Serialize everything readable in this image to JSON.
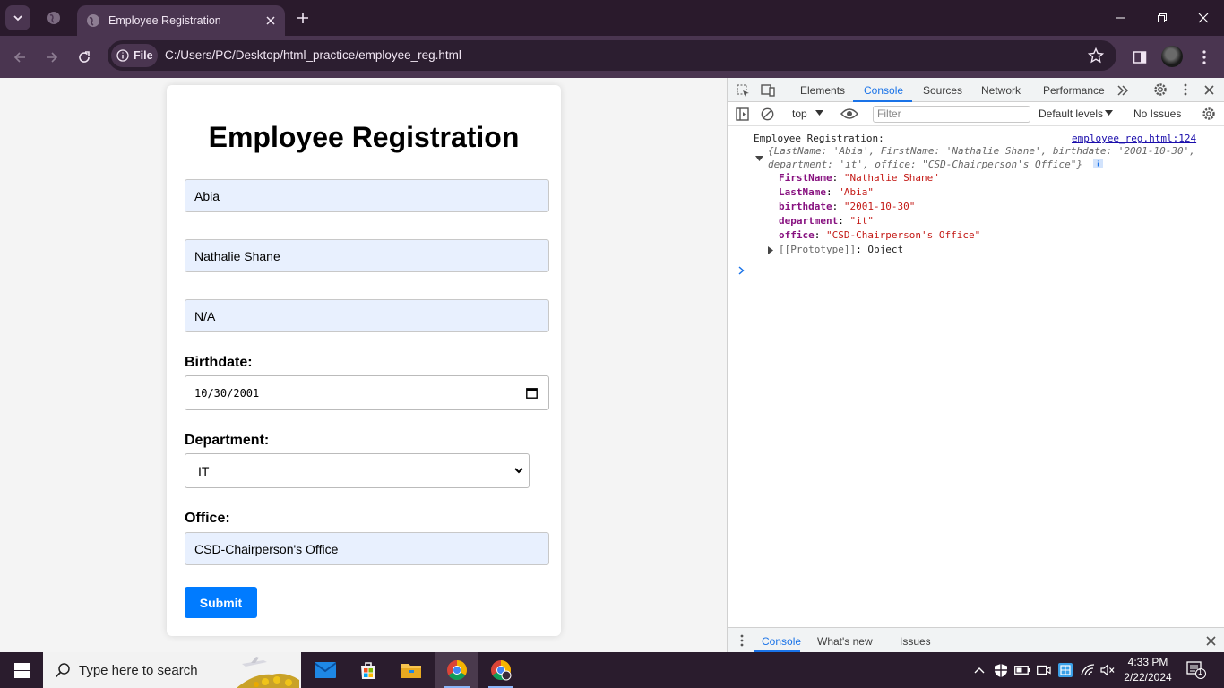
{
  "browser": {
    "tab_title": "Employee Registration",
    "address_chip": "File",
    "url": "C:/Users/PC/Desktop/html_practice/employee_reg.html"
  },
  "form": {
    "title": "Employee Registration",
    "last_name_value": "Abia",
    "first_name_value": "Nathalie Shane",
    "middle_name_value": "N/A",
    "birthdate_label": "Birthdate:",
    "birthdate_value": "10/30/2001",
    "department_label": "Department:",
    "department_value": "IT",
    "office_label": "Office:",
    "office_value": "CSD-Chairperson's Office",
    "submit_label": "Submit"
  },
  "devtools": {
    "tabs": [
      "Elements",
      "Console",
      "Sources",
      "Network",
      "Performance"
    ],
    "active_tab": "Console",
    "context": "top",
    "filter_placeholder": "Filter",
    "levels": "Default levels",
    "issues": "No Issues",
    "log": {
      "message": "Employee Registration:",
      "source": "employee_reg.html:124",
      "preview_line1_pre": "{LastName: ",
      "preview_line1_v1": "'Abia'",
      "preview_line1_mid": ", FirstName: ",
      "preview_line1_v2": "'Nathalie Shane'",
      "preview_line1_mid2": ", birthdate: ",
      "preview_line1_v3": "'2001-10-30'",
      "preview_line1_end": ",",
      "preview_line2_pre": "department: ",
      "preview_line2_v1": "'it'",
      "preview_line2_mid": ", office: ",
      "preview_line2_v2": "\"CSD-Chairperson's Office\"",
      "preview_line2_end": "}",
      "props": [
        {
          "key": "FirstName",
          "value": "\"Nathalie Shane\""
        },
        {
          "key": "LastName",
          "value": "\"Abia\""
        },
        {
          "key": "birthdate",
          "value": "\"2001-10-30\""
        },
        {
          "key": "department",
          "value": "\"it\""
        },
        {
          "key": "office",
          "value": "\"CSD-Chairperson's Office\""
        }
      ],
      "prototype_key": "[[Prototype]]",
      "prototype_value": "Object"
    },
    "drawer_tabs": [
      "Console",
      "What's new",
      "Issues"
    ]
  },
  "taskbar": {
    "search_placeholder": "Type here to search",
    "time": "4:33 PM",
    "date": "2/22/2024",
    "notification_count": "1"
  },
  "colors": {
    "chrome_frame": "#2a1a2c",
    "chrome_toolbar": "#4a3550",
    "submit_blue": "#007bff",
    "autofill_bg": "#e8f0fe",
    "devtools_accent": "#1a73e8"
  }
}
